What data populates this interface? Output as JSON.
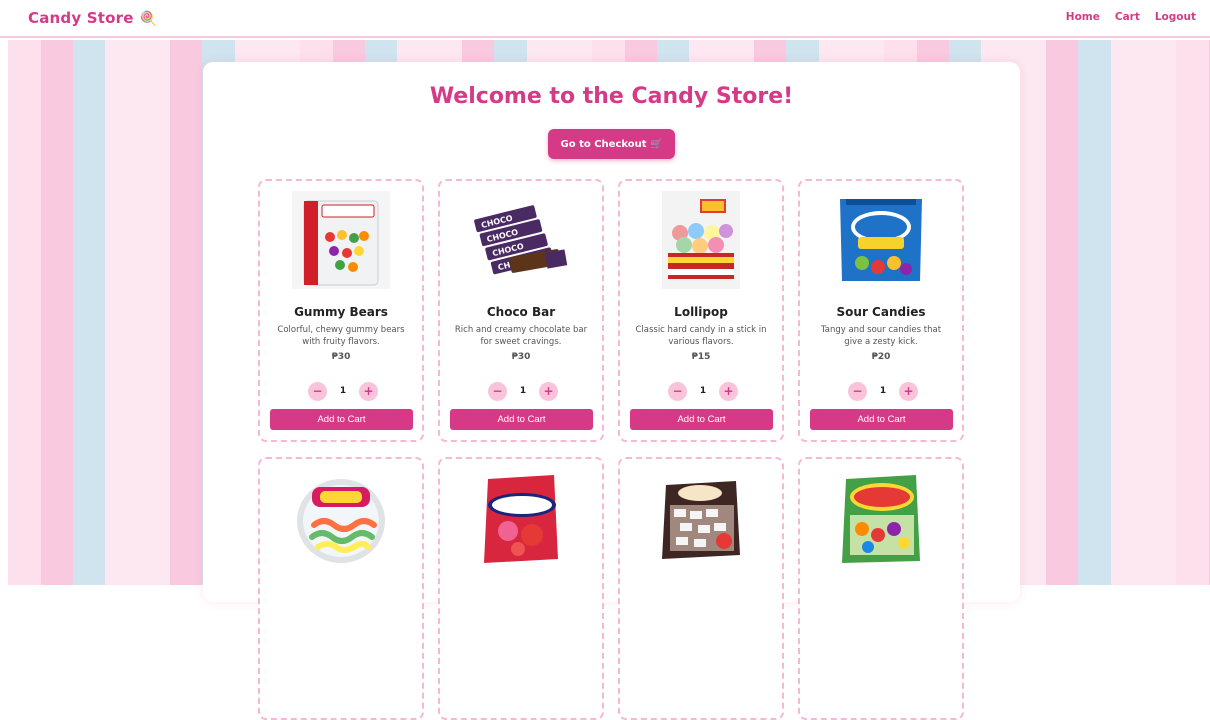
{
  "header": {
    "brand": "Candy Store",
    "brand_icon": "candy-icon",
    "nav": [
      "Home",
      "Cart",
      "Logout"
    ]
  },
  "main": {
    "title": "Welcome to the Candy Store!",
    "checkout_label": "Go to Checkout 🛒",
    "add_label": "Add to Cart",
    "products": [
      {
        "name": "Gummy Bears",
        "desc": "Colorful, chewy gummy bears with fruity flavors.",
        "price": "₱30",
        "qty": "1",
        "image": "gummy-bears-bag"
      },
      {
        "name": "Choco Bar",
        "desc": "Rich and creamy chocolate bar for sweet cravings.",
        "price": "₱30",
        "qty": "1",
        "image": "choco-bar"
      },
      {
        "name": "Lollipop",
        "desc": "Classic hard candy in a stick in various flavors.",
        "price": "₱15",
        "qty": "1",
        "image": "lollipop-box"
      },
      {
        "name": "Sour Candies",
        "desc": "Tangy and sour candies that give a zesty kick.",
        "price": "₱20",
        "qty": "1",
        "image": "jolly-rancher-bag"
      },
      {
        "name": "",
        "desc": "",
        "price": "",
        "qty": "",
        "image": "sour-worms-tub"
      },
      {
        "name": "",
        "desc": "",
        "price": "",
        "qty": "",
        "image": "mentos-bag"
      },
      {
        "name": "",
        "desc": "",
        "price": "",
        "qty": "",
        "image": "choco-joy-bag"
      },
      {
        "name": "",
        "desc": "",
        "price": "",
        "qty": "",
        "image": "frutos-bag"
      }
    ]
  },
  "colors": {
    "accent": "#d63a86",
    "stripe_pink": "#f9cadf",
    "stripe_blue": "#cfe4ef",
    "stripe_light": "#fde8f1"
  }
}
